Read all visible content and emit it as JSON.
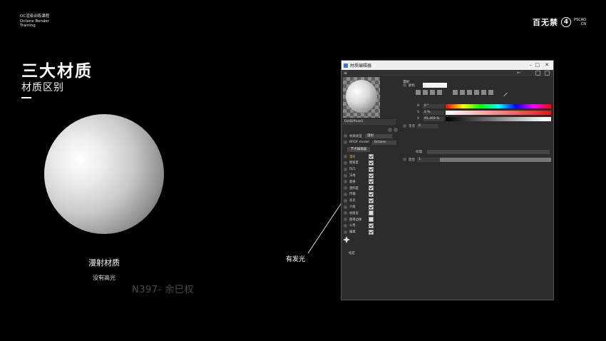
{
  "course": {
    "line1": "OC渲染训练课程",
    "line2": "Octane Render",
    "line3": "Training"
  },
  "brand": {
    "logo": "百无禁",
    "num": "4",
    "site1": "PSCAD",
    "site2": ".CN"
  },
  "slide": {
    "title": "三大材质",
    "subtitle": "材质区别"
  },
  "sphere": {
    "label": "漫射材质",
    "sub": "没有高光"
  },
  "watermark": "N397- 余巳权",
  "callout": "有发光",
  "window": {
    "title": "材质编辑器",
    "material_name": "OctDiffuse1",
    "material_type_label": "材质类型",
    "material_type_value": "漫射",
    "brdf_label": "BRDF model",
    "brdf_value": "Octane",
    "open_editor": "节点编辑器",
    "channels": [
      {
        "label": "漫射",
        "checked": true,
        "active": true
      },
      {
        "label": "粗糙度",
        "checked": true
      },
      {
        "label": "凹凸",
        "checked": true
      },
      {
        "label": "法线",
        "checked": true
      },
      {
        "label": "置换",
        "checked": true
      },
      {
        "label": "透明度",
        "checked": true
      },
      {
        "label": "传输",
        "checked": true
      },
      {
        "label": "发光",
        "checked": true
      },
      {
        "label": "介质",
        "checked": true
      },
      {
        "label": "材质层",
        "checked": false
      },
      {
        "label": "圆滑边缘",
        "checked": false
      },
      {
        "label": "公用",
        "checked": true
      },
      {
        "label": "编辑",
        "checked": true
      }
    ],
    "assign_label": "指定",
    "panel_header": "漫射",
    "color_label": "颜色",
    "h_label": "H",
    "h_value": "0 °",
    "s_label": "S",
    "s_value": "0 %",
    "v_label": "V",
    "v_value": "95.469 %",
    "float_label": "浮点",
    "float_value": "0",
    "texture_label": "纹理",
    "mix_label": "混合",
    "mix_value": "1."
  }
}
